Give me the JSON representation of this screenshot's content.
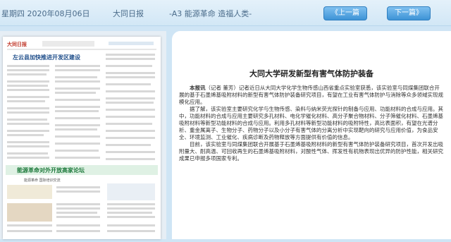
{
  "header": {
    "date": "星期四 2020年08月06日",
    "paper": "大同日报",
    "section": "-A3 能源革命 造福人类-",
    "prev_label": "《上一篇",
    "next_label": "下一篇》"
  },
  "thumbnail": {
    "masthead": "大同日报",
    "headline_1": "左云县加快推进开发区建设",
    "band_headline": "能源革命对外开放高家论坛",
    "sub_headline": "能源革命 国际培训交流"
  },
  "article": {
    "title": "大同大学研发新型有害气体防护装备",
    "byline": "本报讯",
    "para1_rest": "（记者 董芳）记者近日从大同大学化学生物传感山西省重点实验室获悉，该实验室与同煤集团联合开展的基于石墨烯基吸附材料的新型有害气体防护装备研究项目，有望在工业有害气体防护与消除等众多领域实现规模化应用。",
    "para2": "据了解，该实验室主要研究化学与生物传感、染料与纳米荧光探针的制备与应用、功能材料的合成与应用。其中，功能材料的合成与应用主要研究多孔材料、电化学催化材料、高分子聚合物材料、分子筛催化材料、石墨烯基吸附材料等新型功能材料的合成与应用。利用多孔材料等新型功能材料的吸附特性，高比表面积，有望在光谱分析、重金属离子、生物分子、药物分子以及小分子有害气体的分离分析中实现靶向的研究与应用价值，为食品安全、环境监测、工业催化、疾病诊断及药物释放等方面提供有价值的信息。",
    "para3": "目前，该实验室与同煤集团联合开展基于石墨烯基吸附材料的新型有害气体防护装备研究项目，首次开发出吸附量大、耐高温、可回收再生的石墨烯基吸附材料，对酸性气体、挥发性有机物表现出优异的防护性能，相关研究成果已申报多项国家专利。"
  }
}
